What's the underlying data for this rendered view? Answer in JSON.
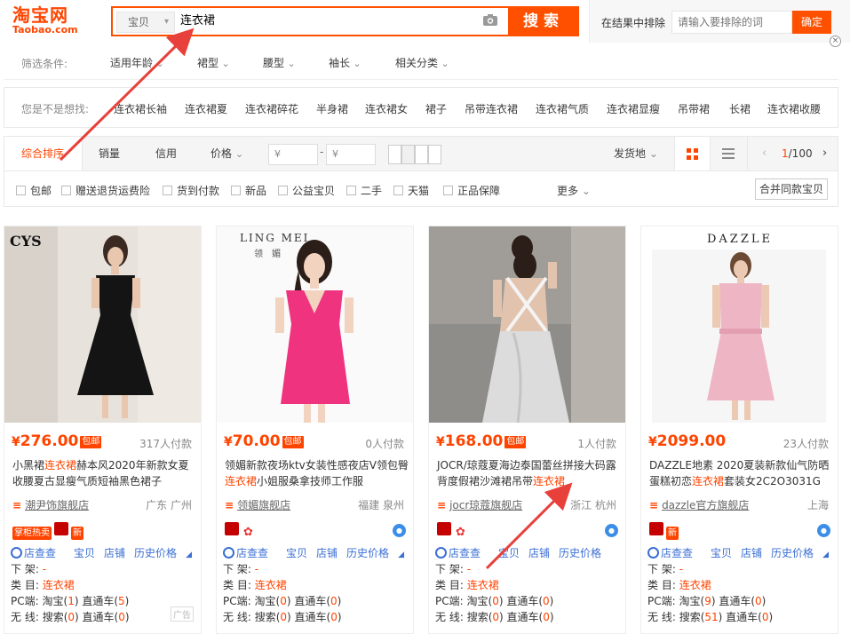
{
  "logo": {
    "cn": "淘宝网",
    "en": "Taobao.com"
  },
  "search": {
    "category": "宝贝",
    "query": "连衣裙",
    "camera_icon": "camera-icon",
    "button": "搜索"
  },
  "exclude": {
    "label": "在结果中排除",
    "placeholder": "请输入要排除的词",
    "confirm": "确定",
    "close": "×"
  },
  "filters": {
    "label": "筛选条件:",
    "items": [
      "适用年龄",
      "裙型",
      "腰型",
      "袖长",
      "相关分类"
    ]
  },
  "suggest": {
    "label": "您是不是想找:",
    "items": [
      "连衣裙长袖",
      "连衣裙夏",
      "连衣裙碎花",
      "半身裙",
      "连衣裙女",
      "裙子",
      "吊带连衣裙",
      "连衣裙气质",
      "连衣裙显瘦",
      "吊带裙",
      "长裙",
      "连衣裙收腰"
    ]
  },
  "sort": {
    "items": [
      "综合排序",
      "销量",
      "信用",
      "价格"
    ],
    "price_from": "¥",
    "price_to": "¥",
    "dash": "-",
    "ship": "发货地",
    "page_current": "1",
    "page_total": "/100",
    "prev": "‹",
    "next": "›"
  },
  "checks": {
    "items": [
      "包邮",
      "赠送退货运费险",
      "货到付款",
      "新品",
      "公益宝贝",
      "二手",
      "天猫",
      "正品保障"
    ],
    "more": "更多",
    "merge": "合并同款宝贝"
  },
  "colors": {
    "accent": "#ff4400",
    "link": "#3b6fd4"
  },
  "products": [
    {
      "price": "276.00",
      "yen": "¥",
      "baoyou": "包邮",
      "sold": "317人付款",
      "title_pre": "小黑裙",
      "title_hl": "连衣裙",
      "title_post": "赫本风2020年新款女夏收腰夏古显瘦气质短袖黑色裙子",
      "shop": "潮尹饰旗舰店",
      "loc": "广东 广州",
      "badges": [
        "掌柜热卖",
        "",
        "新"
      ],
      "tools": [
        "店查查",
        "宝贝",
        "店铺",
        "历史价格"
      ],
      "shelf_label": "下 架:",
      "shelf": "-",
      "cat_label": "类 目:",
      "cat": "连衣裙",
      "pc_label": "PC端:",
      "pc": [
        "淘宝(",
        "1",
        ") 直通车(",
        "5",
        ")"
      ],
      "wx_label": "无 线:",
      "wx": [
        "搜索(",
        "0",
        ") 直通车(",
        "0",
        ")"
      ],
      "ad": "广告"
    },
    {
      "price": "70.00",
      "yen": "¥",
      "baoyou": "包邮",
      "sold": "0人付款",
      "title_pre": "领媚新款夜场ktv女装性感夜店V领包臀",
      "title_hl": "连衣裙",
      "title_post": "小姐服桑拿技师工作服",
      "shop": "领媚旗舰店",
      "loc": "福建 泉州",
      "badges": [
        "",
        "",
        ""
      ],
      "tools": [
        "店查查",
        "宝贝",
        "店铺",
        "历史价格"
      ],
      "shelf_label": "下 架:",
      "shelf": "-",
      "cat_label": "类 目:",
      "cat": "连衣裙",
      "pc_label": "PC端:",
      "pc": [
        "淘宝(",
        "0",
        ") 直通车(",
        "0",
        ")"
      ],
      "wx_label": "无 线:",
      "wx": [
        "搜索(",
        "0",
        ") 直通车(",
        "0",
        ")"
      ],
      "brand": "LING MEI",
      "brand_cn": "领　媚"
    },
    {
      "price": "168.00",
      "yen": "¥",
      "baoyou": "包邮",
      "sold": "1人付款",
      "title_pre": "JOCR/琼蔻夏海边泰国蕾丝拼接大码露背度假裙沙滩裙吊带",
      "title_hl": "连衣裙",
      "title_post": "",
      "shop": "jocr琼蔻旗舰店",
      "loc": "浙江 杭州",
      "badges": [
        "",
        "",
        ""
      ],
      "tools": [
        "店查查",
        "宝贝",
        "店铺",
        "历史价格"
      ],
      "shelf_label": "下 架:",
      "shelf": "-",
      "cat_label": "类 目:",
      "cat": "连衣裙",
      "pc_label": "PC端:",
      "pc": [
        "淘宝(",
        "0",
        ") 直通车(",
        "0",
        ")"
      ],
      "wx_label": "无 线:",
      "wx": [
        "搜索(",
        "0",
        ") 直通车(",
        "0",
        ")"
      ]
    },
    {
      "price": "2099.00",
      "yen": "¥",
      "baoyou": "",
      "sold": "23人付款",
      "title_pre": "DAZZLE地素 2020夏装新款仙气防晒蛋糕初恋",
      "title_hl": "连衣裙",
      "title_post": "套装女2C2O3031G",
      "shop": "dazzle官方旗舰店",
      "loc": "上海",
      "badges": [
        "",
        "新"
      ],
      "tools": [
        "店查查",
        "宝贝",
        "店铺",
        "历史价格"
      ],
      "shelf_label": "下 架:",
      "shelf": "-",
      "cat_label": "类 目:",
      "cat": "连衣裙",
      "pc_label": "PC端:",
      "pc": [
        "淘宝(",
        "9",
        ") 直通车(",
        "0",
        ")"
      ],
      "wx_label": "无 线:",
      "wx": [
        "搜索(",
        "51",
        ") 直通车(",
        "0",
        ")"
      ],
      "brand": "DAZZLE"
    }
  ],
  "brand_cys": "CYS"
}
